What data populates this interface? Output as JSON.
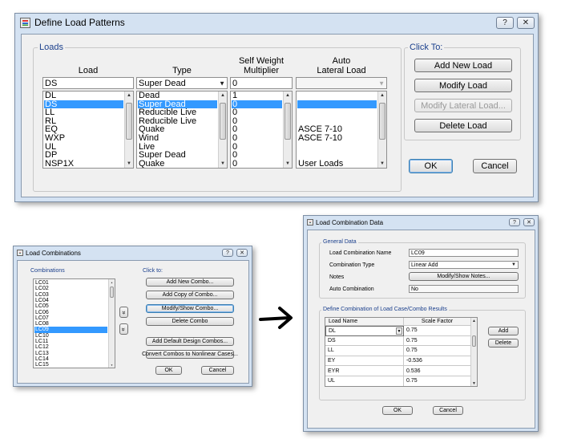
{
  "define_load_patterns": {
    "title": "Define Load Patterns",
    "help_icon": "?",
    "close_icon": "✕",
    "loads_group_title": "Loads",
    "click_to_group_title": "Click To:",
    "headers": {
      "load": "Load",
      "type": "Type",
      "self_weight_line1": "Self Weight",
      "self_weight_line2": "Multiplier",
      "auto_line1": "Auto",
      "auto_line2": "Lateral Load"
    },
    "inputs": {
      "load_value": "DS",
      "type_value": "Super Dead",
      "multiplier_value": "0",
      "auto_value": ""
    },
    "rows": [
      {
        "load": "DL",
        "type": "Dead",
        "mult": "1",
        "auto": ""
      },
      {
        "load": "DS",
        "type": "Super Dead",
        "mult": "0",
        "auto": ""
      },
      {
        "load": "LL",
        "type": "Reducible Live",
        "mult": "0",
        "auto": ""
      },
      {
        "load": "RL",
        "type": "Reducible Live",
        "mult": "0",
        "auto": ""
      },
      {
        "load": "EQ",
        "type": "Quake",
        "mult": "0",
        "auto": "ASCE 7-10"
      },
      {
        "load": "WXP",
        "type": "Wind",
        "mult": "0",
        "auto": "ASCE 7-10"
      },
      {
        "load": "UL",
        "type": "Live",
        "mult": "0",
        "auto": ""
      },
      {
        "load": "DP",
        "type": "Super Dead",
        "mult": "0",
        "auto": ""
      },
      {
        "load": "NSP1X",
        "type": "Quake",
        "mult": "0",
        "auto": "User Loads"
      }
    ],
    "selected_row": 1,
    "buttons": {
      "add_new_load": "Add New Load",
      "modify_load": "Modify Load",
      "modify_lateral_load": "Modify Lateral Load...",
      "delete_load": "Delete Load",
      "ok": "OK",
      "cancel": "Cancel"
    }
  },
  "load_combinations": {
    "title": "Load Combinations",
    "help_icon": "?",
    "close_icon": "✕",
    "combinations_label": "Combinations",
    "click_to_label": "Click to:",
    "items": [
      "LC01",
      "LC02",
      "LC03",
      "LC04",
      "LC05",
      "LC06",
      "LC07",
      "LC08",
      "LC09",
      "LC10",
      "LC11",
      "LC12",
      "LC13",
      "LC14",
      "LC15"
    ],
    "selected_index": 8,
    "move_up_icon": "«",
    "move_down_icon": "»",
    "buttons": {
      "add_new_combo": "Add New Combo...",
      "add_copy_of_combo": "Add Copy of Combo...",
      "modify_show_combo": "Modify/Show Combo...",
      "delete_combo": "Delete Combo",
      "add_default_design_combos": "Add Default Design Combos...",
      "convert_combos": "Convert Combos to Nonlinear Cases...",
      "ok": "OK",
      "cancel": "Cancel"
    }
  },
  "arrow_glyph": "➜",
  "load_combination_data": {
    "title": "Load Combination Data",
    "help_icon": "?",
    "close_icon": "✕",
    "general_data_label": "General Data",
    "fields": {
      "name_label": "Load Combination Name",
      "name_value": "LC09",
      "type_label": "Combination Type",
      "type_value": "Linear Add",
      "notes_label": "Notes",
      "notes_button": "Modify/Show Notes...",
      "auto_label": "Auto Combination",
      "auto_value": "No"
    },
    "define_label": "Define Combination of Load Case/Combo Results",
    "grid_headers": {
      "load_name": "Load Name",
      "scale_factor": "Scale Factor"
    },
    "grid_rows": [
      {
        "load_name": "DL",
        "scale_factor": "0.75"
      },
      {
        "load_name": "DS",
        "scale_factor": "0.75"
      },
      {
        "load_name": "LL",
        "scale_factor": "0.75"
      },
      {
        "load_name": "EY",
        "scale_factor": "-0.536"
      },
      {
        "load_name": "EYR",
        "scale_factor": "0.536"
      },
      {
        "load_name": "UL",
        "scale_factor": "0.75"
      }
    ],
    "buttons": {
      "add": "Add",
      "delete": "Delete",
      "ok": "OK",
      "cancel": "Cancel"
    }
  }
}
